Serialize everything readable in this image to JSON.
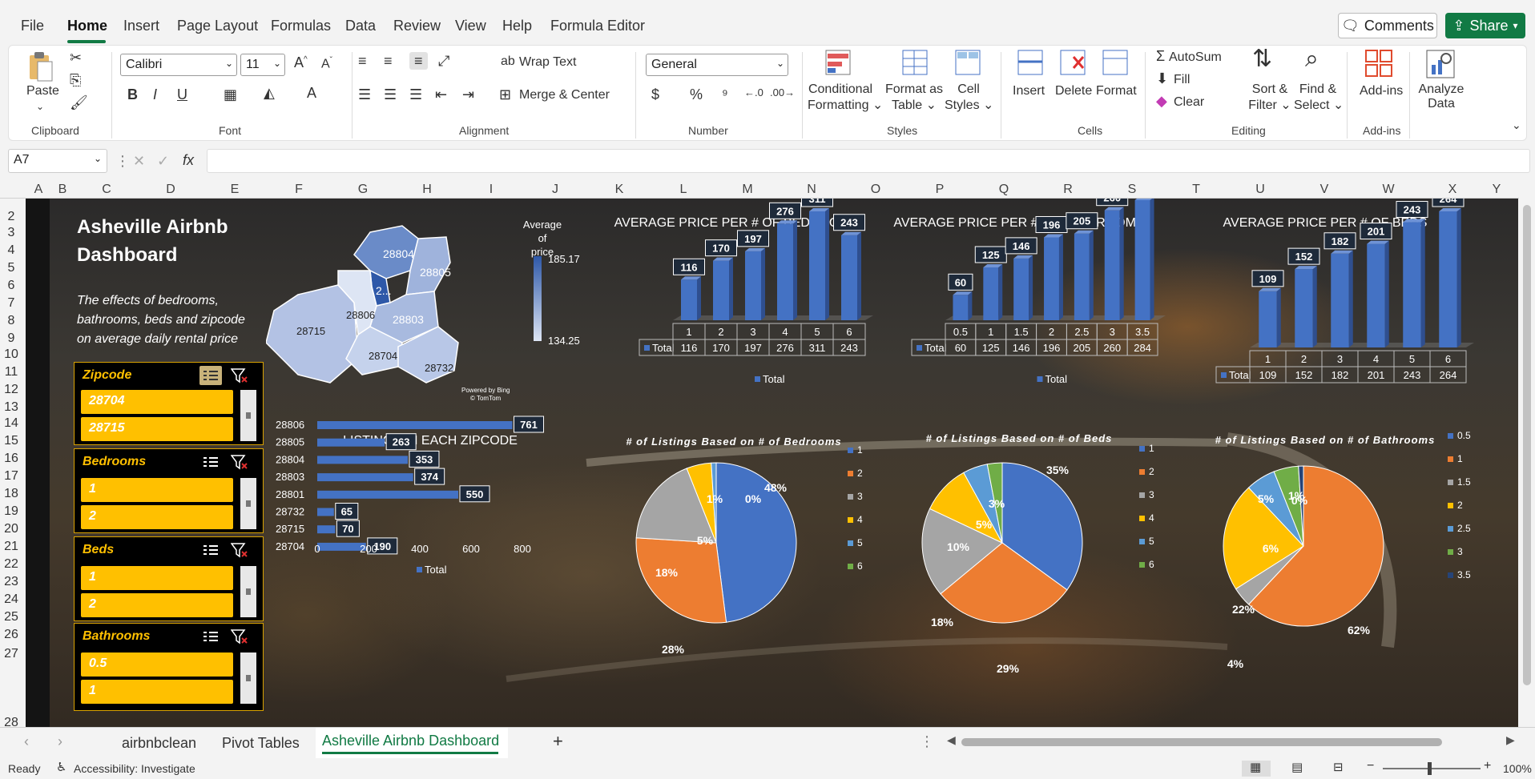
{
  "menu": {
    "items": [
      "File",
      "Home",
      "Insert",
      "Page Layout",
      "Formulas",
      "Data",
      "Review",
      "View",
      "Help",
      "Formula Editor"
    ],
    "comments_label": "Comments",
    "share_label": "Share"
  },
  "ribbon": {
    "clipboard": {
      "paste": "Paste",
      "group": "Clipboard"
    },
    "font": {
      "name": "Calibri",
      "size": "11",
      "group": "Font",
      "bold": "B",
      "italic": "I",
      "underline": "U"
    },
    "alignment": {
      "wrap": "Wrap Text",
      "merge": "Merge & Center",
      "group": "Alignment"
    },
    "number": {
      "format": "General",
      "group": "Number",
      "currency": "$",
      "percent": "%"
    },
    "styles": {
      "conditional_1": "Conditional",
      "conditional_2": "Formatting",
      "format_table_1": "Format as",
      "format_table_2": "Table",
      "cell_styles_1": "Cell",
      "cell_styles_2": "Styles",
      "group": "Styles"
    },
    "cells": {
      "insert": "Insert",
      "delete": "Delete",
      "format": "Format",
      "group": "Cells"
    },
    "editing": {
      "autosum": "AutoSum",
      "fill": "Fill",
      "clear": "Clear",
      "sort_1": "Sort &",
      "sort_2": "Filter",
      "find_1": "Find &",
      "find_2": "Select",
      "group": "Editing"
    },
    "addins": {
      "addins": "Add-ins",
      "group": "Add-ins"
    },
    "analyze": {
      "line1": "Analyze",
      "line2": "Data"
    }
  },
  "formula_bar": {
    "name_box": "A7",
    "fx": "fx",
    "value": ""
  },
  "columns": [
    "A",
    "B",
    "C",
    "D",
    "E",
    "F",
    "G",
    "H",
    "I",
    "J",
    "K",
    "L",
    "M",
    "N",
    "O",
    "P",
    "Q",
    "R",
    "S",
    "T",
    "U",
    "V",
    "W",
    "X",
    "Y"
  ],
  "rows": [
    "2",
    "3",
    "4",
    "5",
    "6",
    "7",
    "8",
    "9",
    "10",
    "11",
    "12",
    "13",
    "14",
    "15",
    "16",
    "17",
    "18",
    "19",
    "20",
    "21",
    "22",
    "23",
    "24",
    "25",
    "26",
    "27",
    "28"
  ],
  "dashboard": {
    "title_line1": "Asheville Airbnb",
    "title_line2": "Dashboard",
    "subtitle_line1": "The effects of bedrooms,",
    "subtitle_line2": "bathrooms, beds and zipcode",
    "subtitle_line3": "on average daily rental price",
    "slicers": [
      {
        "title": "Zipcode",
        "items": [
          "28704",
          "28715"
        ]
      },
      {
        "title": "Bedrooms",
        "items": [
          "1",
          "2"
        ]
      },
      {
        "title": "Beds",
        "items": [
          "1",
          "2"
        ]
      },
      {
        "title": "Bathrooms",
        "items": [
          "0.5",
          "1"
        ]
      }
    ],
    "map": {
      "legend_title_1": "Average of",
      "legend_title_2": "price",
      "legend_max": "185.17",
      "legend_min": "134.25",
      "credit_1": "Powered by Bing",
      "credit_2": "© TomTom",
      "zips": [
        "28804",
        "28805",
        "2...",
        "28715",
        "28806",
        "28803",
        "28704",
        "28732"
      ]
    }
  },
  "chart_data": [
    {
      "type": "bar",
      "title": "AVERAGE PRICE PER # OF BEDROOMS",
      "categories": [
        "1",
        "2",
        "3",
        "4",
        "5",
        "6"
      ],
      "series": [
        {
          "name": "Total",
          "values": [
            116,
            170,
            197,
            276,
            311,
            243
          ]
        }
      ],
      "table_label": "Total",
      "legend": "bottom"
    },
    {
      "type": "bar",
      "title": "AVERAGE PRICE PER # OF BATHROOMS",
      "categories": [
        "0.5",
        "1",
        "1.5",
        "2",
        "2.5",
        "3",
        "3.5"
      ],
      "series": [
        {
          "name": "Total",
          "values": [
            60,
            125,
            146,
            196,
            205,
            260,
            284
          ]
        }
      ],
      "table_label": "Total",
      "legend": "bottom"
    },
    {
      "type": "bar",
      "title": "AVERAGE PRICE PER # OF BEDS",
      "categories": [
        "1",
        "2",
        "3",
        "4",
        "5",
        "6"
      ],
      "series": [
        {
          "name": "Total",
          "values": [
            109,
            152,
            182,
            201,
            243,
            264
          ]
        }
      ],
      "table_label": "Total",
      "legend": "none"
    },
    {
      "type": "bar",
      "orientation": "horizontal",
      "title": "LISTINGS IN EACH ZIPCODE",
      "categories": [
        "28806",
        "28805",
        "28804",
        "28803",
        "28801",
        "28732",
        "28715",
        "28704"
      ],
      "series": [
        {
          "name": "Total",
          "values": [
            761,
            263,
            353,
            374,
            550,
            65,
            70,
            190
          ]
        }
      ],
      "ticks": [
        "0",
        "200",
        "400",
        "600",
        "800"
      ],
      "xlim": [
        0,
        800
      ],
      "legend": "bottom"
    },
    {
      "type": "pie",
      "title": "# of Listings Based on # of Bedrooms",
      "categories": [
        "1",
        "2",
        "3",
        "4",
        "5",
        "6"
      ],
      "values": [
        48,
        28,
        18,
        5,
        1,
        0
      ],
      "labels": [
        "48%",
        "28%",
        "18%",
        "5%",
        "1%",
        "0%"
      ],
      "colors": [
        "#4472c4",
        "#ed7d31",
        "#a5a5a5",
        "#ffc000",
        "#5b9bd5",
        "#70ad47"
      ],
      "legend": "right"
    },
    {
      "type": "pie",
      "title": "# of Listings Based on # of Beds",
      "categories": [
        "1",
        "2",
        "3",
        "4",
        "5",
        "6"
      ],
      "values": [
        35,
        29,
        18,
        10,
        5,
        3
      ],
      "labels": [
        "35%",
        "29%",
        "18%",
        "10%",
        "5%",
        "3%"
      ],
      "colors": [
        "#4472c4",
        "#ed7d31",
        "#a5a5a5",
        "#ffc000",
        "#5b9bd5",
        "#70ad47"
      ],
      "legend": "right"
    },
    {
      "type": "pie",
      "title": "# of Listings Based on # of Bathrooms",
      "categories": [
        "0.5",
        "1",
        "1.5",
        "2",
        "2.5",
        "3",
        "3.5"
      ],
      "values": [
        0,
        62,
        4,
        22,
        6,
        5,
        1
      ],
      "labels": [
        "0%",
        "62%",
        "4%",
        "22%",
        "6%",
        "5%",
        "1%"
      ],
      "colors": [
        "#4472c4",
        "#ed7d31",
        "#a5a5a5",
        "#ffc000",
        "#5b9bd5",
        "#70ad47",
        "#264478"
      ],
      "legend": "right"
    }
  ],
  "sheets": {
    "tabs": [
      "airbnbclean",
      "Pivot Tables",
      "Asheville Airbnb Dashboard"
    ],
    "active": "Asheville Airbnb Dashboard"
  },
  "status": {
    "ready": "Ready",
    "accessibility": "Accessibility: Investigate",
    "zoom": "100%"
  },
  "colors": {
    "accent": "#117a44",
    "bar": "#4472c4",
    "slicer": "#ffc000"
  }
}
